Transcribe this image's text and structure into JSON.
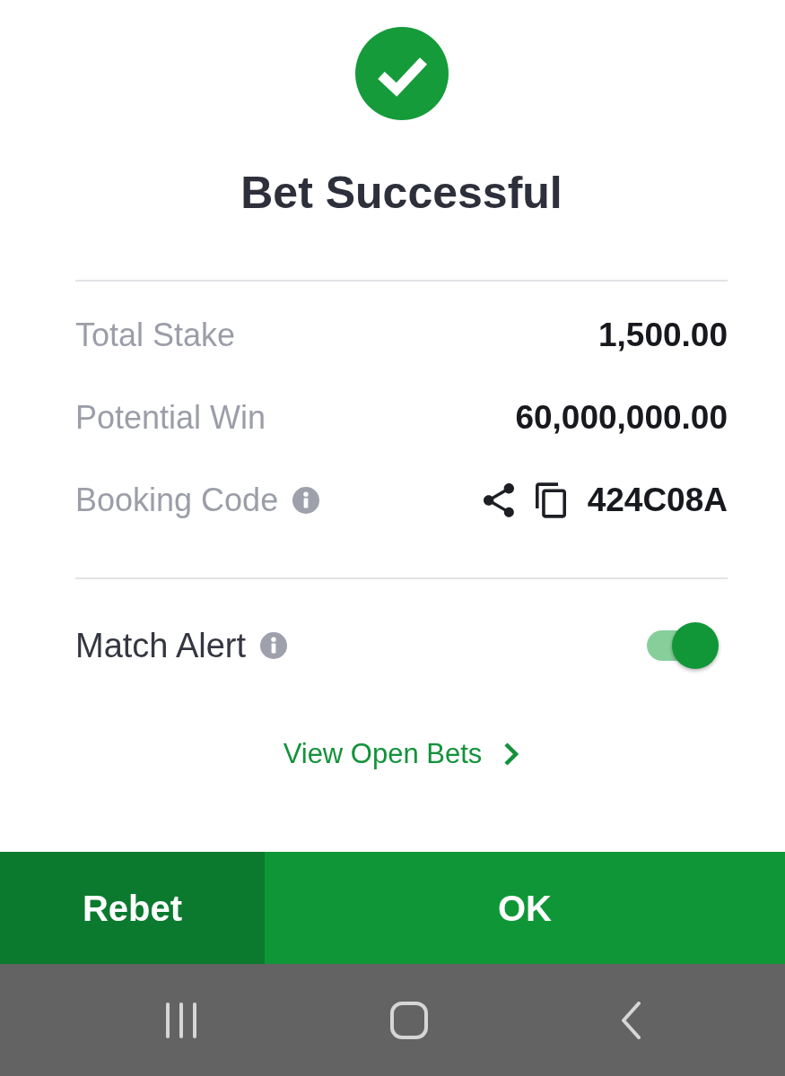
{
  "header": {
    "title": "Bet Successful"
  },
  "summary": [
    {
      "kind": "plain",
      "label": "Total Stake",
      "value": "1,500.00"
    },
    {
      "kind": "plain",
      "label": "Potential Win",
      "value": "60,000,000.00"
    },
    {
      "kind": "code",
      "label": "Booking Code",
      "value": "424C08A"
    }
  ],
  "match_alert": {
    "label": "Match Alert",
    "on": true
  },
  "link": {
    "label": "View Open Bets"
  },
  "actions": [
    {
      "kind": "secondary",
      "label": "Rebet"
    },
    {
      "kind": "primary",
      "label": "OK"
    }
  ]
}
